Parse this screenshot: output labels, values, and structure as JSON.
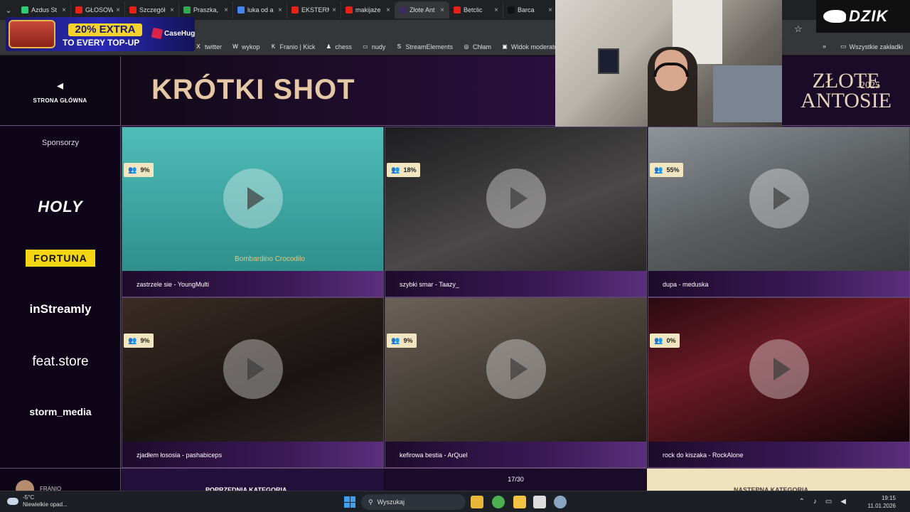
{
  "browser": {
    "tabs": [
      {
        "title": "Azdus St",
        "color": "#2ecc71",
        "active": false
      },
      {
        "title": "GŁOSOW",
        "color": "#e62117",
        "active": false
      },
      {
        "title": "Szczegół",
        "color": "#e62117",
        "active": false
      },
      {
        "title": "Praszka,",
        "color": "#34a853",
        "active": false
      },
      {
        "title": "luka od a",
        "color": "#4285f4",
        "active": false
      },
      {
        "title": "EKSTERM",
        "color": "#e62117",
        "active": false
      },
      {
        "title": "makijaże",
        "color": "#e62117",
        "active": false
      },
      {
        "title": "Złote Ant",
        "color": "#3a2a5e",
        "active": true
      },
      {
        "title": "Betclic",
        "color": "#e62117",
        "active": false
      },
      {
        "title": "Barca",
        "color": "#111111",
        "active": false
      }
    ],
    "bookmarks": [
      {
        "label": "twitter",
        "icon": "X"
      },
      {
        "label": "wykop",
        "icon": "W"
      },
      {
        "label": "Franio | Kick",
        "icon": "K"
      },
      {
        "label": "chess",
        "icon": "♟"
      },
      {
        "label": "nudy",
        "icon": "▭"
      },
      {
        "label": "StreamElements",
        "icon": "S"
      },
      {
        "label": "Chłam",
        "icon": "◎"
      },
      {
        "label": "Widok moderatora...",
        "icon": "▣"
      }
    ],
    "all_bookmarks": "Wszystkie zakładki"
  },
  "ad": {
    "line1": "20% EXTRA",
    "line2": "TO EVERY TOP-UP",
    "brand": "CaseHug"
  },
  "overlay": {
    "brand": "DZIK"
  },
  "site": {
    "home_label": "STRONA GŁÓWNA",
    "category_title": "KRÓTKI SHOT",
    "logo_line1": "ZŁOTE",
    "logo_line2": "ANTOSIE",
    "logo_year": "2025",
    "sponsors_title": "Sponsorzy",
    "sponsors": [
      "HOLY",
      "FORTUNA",
      "inStreamly",
      "feat.store",
      "storm_media"
    ]
  },
  "clips": [
    {
      "title": "zastrzele sie - YoungMulti",
      "percent": "9%",
      "watermark": "Bombardino Crocodilo"
    },
    {
      "title": "szybki smar - Taazy_",
      "percent": "18%",
      "watermark": ""
    },
    {
      "title": "dupa - meduska",
      "percent": "55%",
      "watermark": ""
    },
    {
      "title": "zjadłem łososia - pashabiceps",
      "percent": "9%",
      "watermark": ""
    },
    {
      "title": "kefirowa bestia - ArQuel",
      "percent": "9%",
      "watermark": ""
    },
    {
      "title": "rock do kiszaka - RockAlone",
      "percent": "0%",
      "watermark": ""
    }
  ],
  "pagination": {
    "prev_label": "POPRZEDNIA KATEGORIA",
    "page": "17/30",
    "next_label": "NASTĘPNA KATEGORIA",
    "user": "FRANIO"
  },
  "taskbar": {
    "temperature": "-5°C",
    "weather": "Niewielkie opad...",
    "search": "Wyszukaj",
    "time": "19:15",
    "date": "11.01.2026"
  }
}
